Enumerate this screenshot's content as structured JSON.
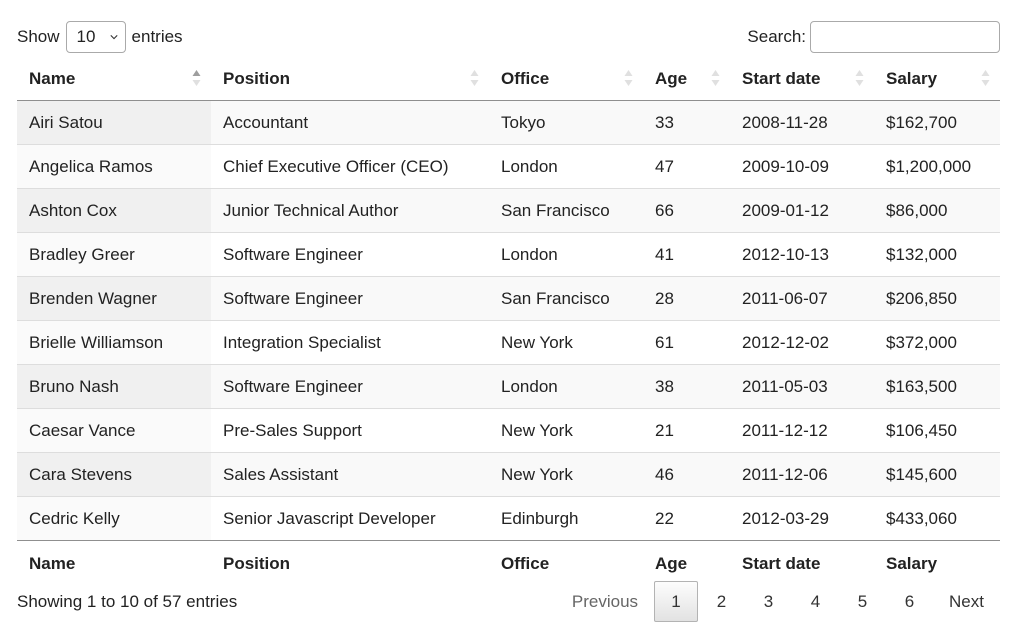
{
  "length_menu": {
    "prefix": "Show",
    "selected": "10",
    "suffix": "entries"
  },
  "search": {
    "label": "Search:",
    "value": "",
    "placeholder": ""
  },
  "columns": [
    "Name",
    "Position",
    "Office",
    "Age",
    "Start date",
    "Salary"
  ],
  "sorted_column": "Name",
  "sort_direction": "ascending",
  "rows": [
    [
      "Airi Satou",
      "Accountant",
      "Tokyo",
      "33",
      "2008-11-28",
      "$162,700"
    ],
    [
      "Angelica Ramos",
      "Chief Executive Officer (CEO)",
      "London",
      "47",
      "2009-10-09",
      "$1,200,000"
    ],
    [
      "Ashton Cox",
      "Junior Technical Author",
      "San Francisco",
      "66",
      "2009-01-12",
      "$86,000"
    ],
    [
      "Bradley Greer",
      "Software Engineer",
      "London",
      "41",
      "2012-10-13",
      "$132,000"
    ],
    [
      "Brenden Wagner",
      "Software Engineer",
      "San Francisco",
      "28",
      "2011-06-07",
      "$206,850"
    ],
    [
      "Brielle Williamson",
      "Integration Specialist",
      "New York",
      "61",
      "2012-12-02",
      "$372,000"
    ],
    [
      "Bruno Nash",
      "Software Engineer",
      "London",
      "38",
      "2011-05-03",
      "$163,500"
    ],
    [
      "Caesar Vance",
      "Pre-Sales Support",
      "New York",
      "21",
      "2011-12-12",
      "$106,450"
    ],
    [
      "Cara Stevens",
      "Sales Assistant",
      "New York",
      "46",
      "2011-12-06",
      "$145,600"
    ],
    [
      "Cedric Kelly",
      "Senior Javascript Developer",
      "Edinburgh",
      "22",
      "2012-03-29",
      "$433,060"
    ]
  ],
  "info": "Showing 1 to 10 of 57 entries",
  "pagination": {
    "previous": "Previous",
    "pages": [
      "1",
      "2",
      "3",
      "4",
      "5",
      "6"
    ],
    "current": "1",
    "next": "Next"
  },
  "colors": {
    "sort_active": "#9e9e9e",
    "sort_inactive": "#e0e0e0",
    "row_stripe": "#f9f9f9",
    "sorted_stripe": "#f0f0f0"
  }
}
